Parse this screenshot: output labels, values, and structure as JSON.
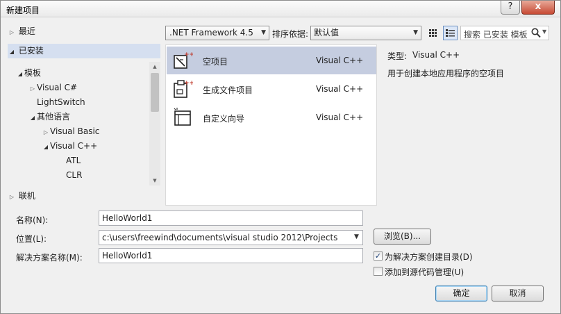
{
  "window": {
    "title": "新建项目",
    "help": "?",
    "close": "x"
  },
  "nav": {
    "recent": "最近",
    "installed": "已安装",
    "online": "联机",
    "tree": [
      {
        "label": "模板",
        "level": 0,
        "arrow": "down"
      },
      {
        "label": "Visual C#",
        "level": 1,
        "arrow": "right"
      },
      {
        "label": "LightSwitch",
        "level": 1,
        "arrow": "none"
      },
      {
        "label": "其他语言",
        "level": 1,
        "arrow": "down"
      },
      {
        "label": "Visual Basic",
        "level": 2,
        "arrow": "right"
      },
      {
        "label": "Visual C++",
        "level": 2,
        "arrow": "down"
      },
      {
        "label": "ATL",
        "level": 3,
        "arrow": "none"
      },
      {
        "label": "CLR",
        "level": 3,
        "arrow": "none"
      }
    ]
  },
  "toolbar": {
    "framework": ".NET Framework 4.5",
    "sort_label": "排序依据:",
    "sort_value": "默认值",
    "search_placeholder": "搜索 已安装 模板"
  },
  "templates": [
    {
      "name": "空项目",
      "language": "Visual C++",
      "selected": true,
      "icon": "empty-project-icon"
    },
    {
      "name": "生成文件项目",
      "language": "Visual C++",
      "selected": false,
      "icon": "makefile-project-icon"
    },
    {
      "name": "自定义向导",
      "language": "Visual C++",
      "selected": false,
      "icon": "custom-wizard-icon"
    }
  ],
  "details": {
    "type_label": "类型:",
    "type_value": "Visual C++",
    "description": "用于创建本地应用程序的空项目"
  },
  "form": {
    "name_label": "名称(N):",
    "name_value": "HelloWorld1",
    "location_label": "位置(L):",
    "location_value": "c:\\users\\freewind\\documents\\visual studio 2012\\Projects",
    "solution_label": "解决方案名称(M):",
    "solution_value": "HelloWorld1",
    "browse": "浏览(B)...",
    "create_dir_label": "为解决方案创建目录(D)",
    "create_dir_checked": true,
    "source_control_label": "添加到源代码管理(U)",
    "source_control_checked": false,
    "ok": "确定",
    "cancel": "取消"
  },
  "colors": {
    "selection": "#c5cde0",
    "nav_selection": "#d5dff0",
    "accent": "#3c7fb1"
  }
}
